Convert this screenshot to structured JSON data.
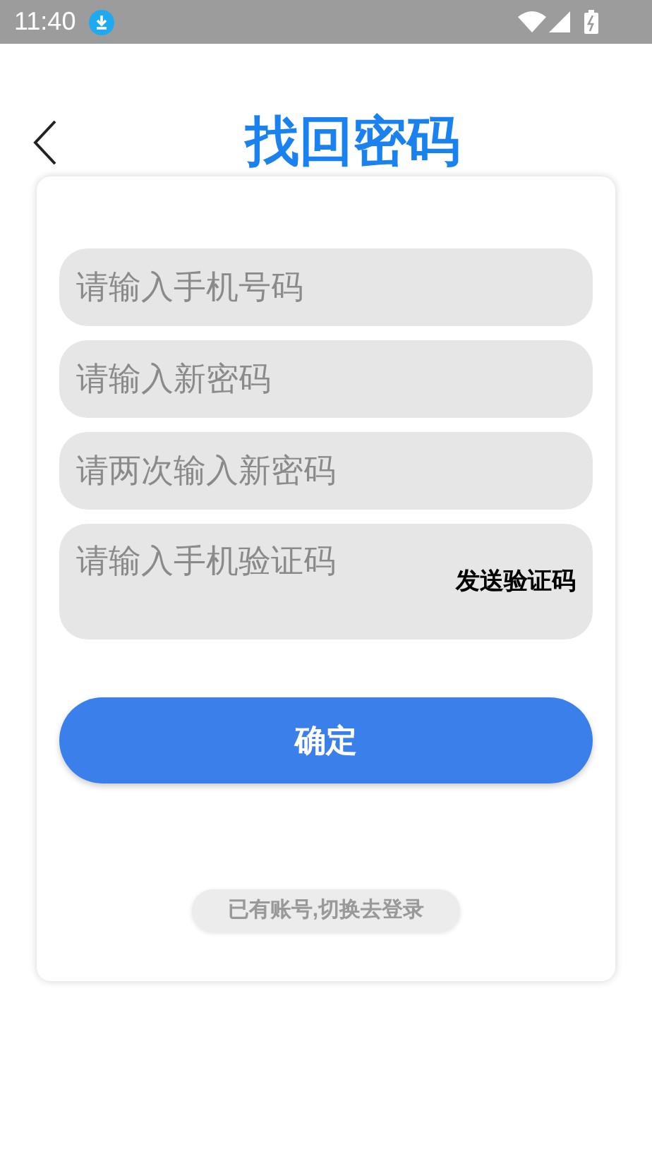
{
  "status_bar": {
    "time": "11:40"
  },
  "header": {
    "title": "找回密码"
  },
  "fields": [
    {
      "placeholder": "请输入手机号码",
      "kind": "text"
    },
    {
      "placeholder": "请输入新密码",
      "kind": "text"
    },
    {
      "placeholder": "请两次输入新密码",
      "kind": "text"
    },
    {
      "placeholder": "请输入手机验证码",
      "kind": "code",
      "action": "发送验证码"
    }
  ],
  "confirm_button": "确定",
  "login_link": "已有账号,切换去登录"
}
